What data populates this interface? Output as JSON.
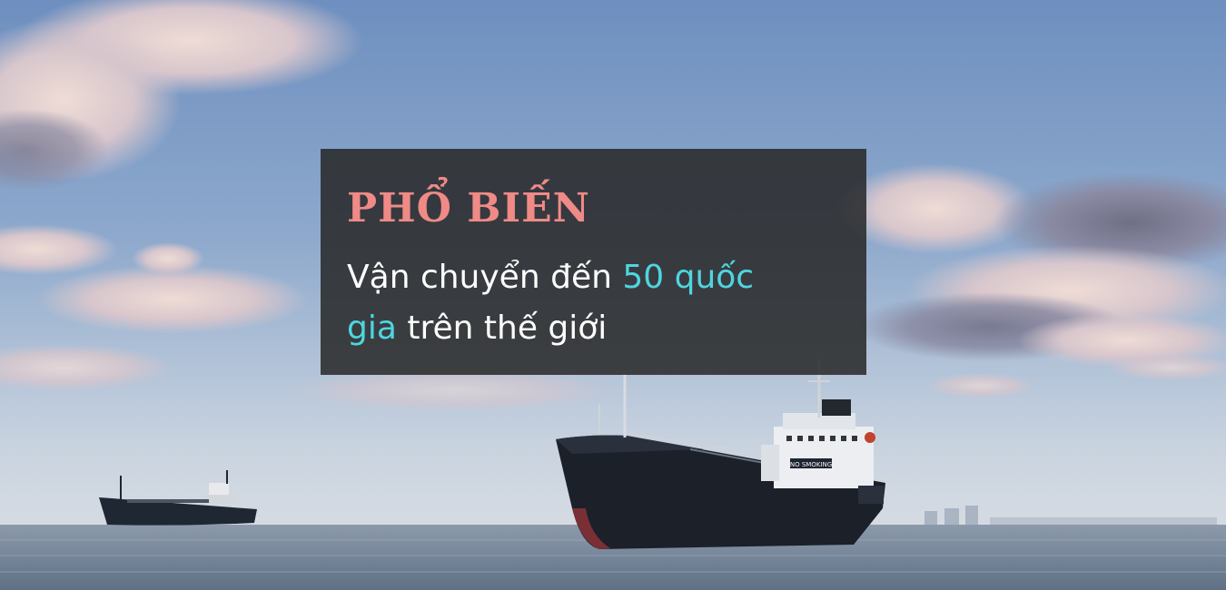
{
  "headline": "PHỔ BIẾN",
  "body": {
    "part1": "Vận chuyển đến ",
    "highlight1": "50 quốc",
    "highlight2": "gia",
    "part2": " trên thế giới"
  },
  "ship_sign": "NO SMOKING",
  "colors": {
    "headline": "#f08a86",
    "highlight": "#4fd5df",
    "body_text": "#ffffff",
    "card_bg": "#2a2a2a"
  }
}
